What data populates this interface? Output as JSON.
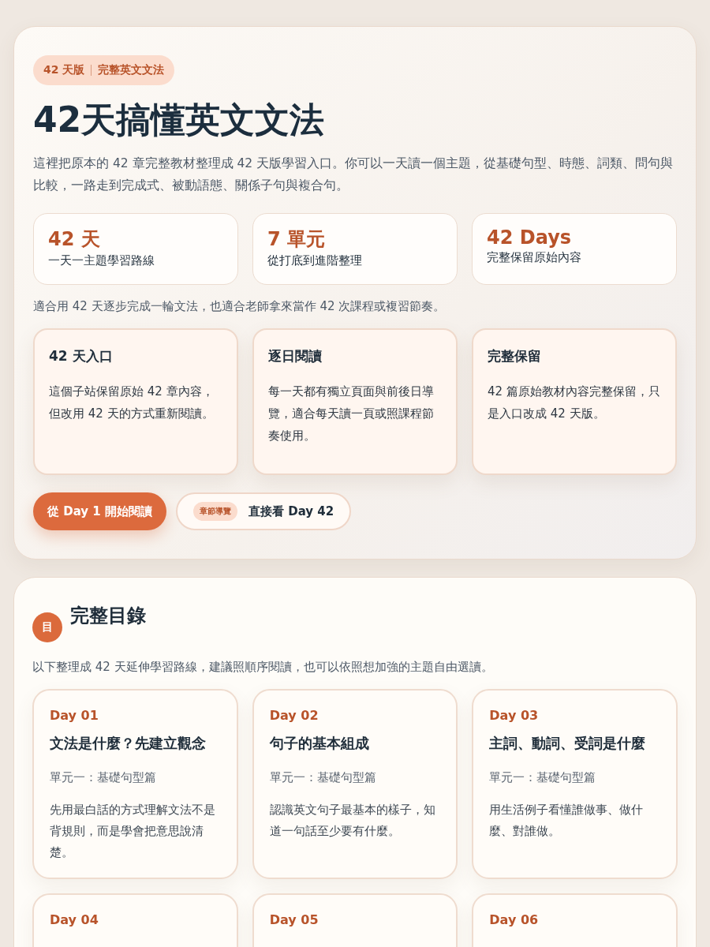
{
  "hero": {
    "badge": {
      "edition": "42 天版",
      "subject": "完整英文文法"
    },
    "title": "42天搞懂英文文法",
    "intro": "這裡把原本的 42 章完整教材整理成 42 天版學習入口。你可以一天讀一個主題，從基礎句型、時態、詞類、問句與比較，一路走到完成式、被動語態、關係子句與複合句。",
    "stats": [
      {
        "value": "42 天",
        "label": "一天一主題學習路線"
      },
      {
        "value": "7 單元",
        "label": "從打底到進階整理"
      },
      {
        "value": "42 Days",
        "label": "完整保留原始內容"
      }
    ],
    "note": "適合用 42 天逐步完成一輪文法，也適合老師拿來當作 42 次課程或複習節奏。",
    "features": [
      {
        "title": "42 天入口",
        "text": "這個子站保留原始 42 章內容，但改用 42 天的方式重新閱讀。"
      },
      {
        "title": "逐日閱讀",
        "text": "每一天都有獨立頁面與前後日導覽，適合每天讀一頁或照課程節奏使用。"
      },
      {
        "title": "完整保留",
        "text": "42 篇原始教材內容完整保留，只是入口改成 42 天版。"
      }
    ],
    "actions": [
      {
        "kind": "primary",
        "label": "從 Day 1 開始閱讀"
      },
      {
        "kind": "secondary",
        "tag": "章節導覽",
        "label": "直接看 Day 42"
      }
    ]
  },
  "toc": {
    "icon": "目",
    "title": "完整目錄",
    "intro": "以下整理成 42 天延伸學習路線，建議照順序閱讀，也可以依照想加強的主題自由選讀。",
    "days": [
      {
        "day": "Day 01",
        "title": "文法是什麼？先建立觀念",
        "unit": "單元一：基礎句型篇",
        "text": "先用最白話的方式理解文法不是背規則，而是學會把意思說清楚。"
      },
      {
        "day": "Day 02",
        "title": "句子的基本組成",
        "unit": "單元一：基礎句型篇",
        "text": "認識英文句子最基本的樣子，知道一句話至少要有什麼。"
      },
      {
        "day": "Day 03",
        "title": "主詞、動詞、受詞是什麼",
        "unit": "單元一：基礎句型篇",
        "text": "用生活例子看懂誰做事、做什麼、對誰做。"
      },
      {
        "day": "Day 04"
      },
      {
        "day": "Day 05"
      },
      {
        "day": "Day 06"
      }
    ]
  }
}
